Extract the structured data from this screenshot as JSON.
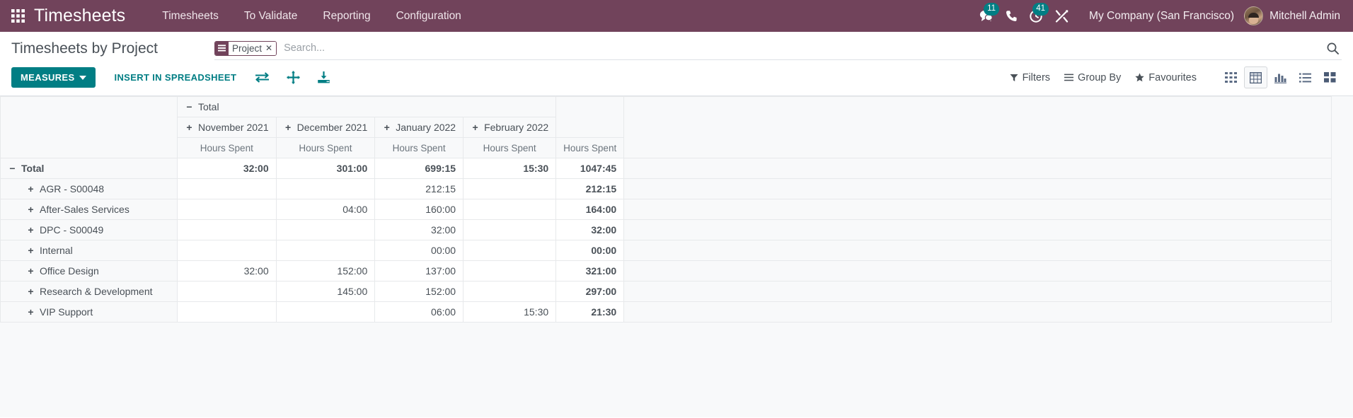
{
  "navbar": {
    "apps_icon": "apps-grid-icon",
    "brand": "Timesheets",
    "menu": [
      {
        "label": "Timesheets"
      },
      {
        "label": "To Validate"
      },
      {
        "label": "Reporting"
      },
      {
        "label": "Configuration"
      }
    ],
    "messages_badge": "11",
    "activities_badge": "41",
    "company": "My Company (San Francisco)",
    "user": "Mitchell Admin",
    "brand_color": "#71435B",
    "badge_color": "#017E84"
  },
  "control_panel": {
    "title": "Timesheets by Project",
    "search": {
      "facet_label": "Project",
      "facet_close": "✕",
      "placeholder": "Search..."
    },
    "measures_label": "MEASURES",
    "insert_label": "INSERT IN SPREADSHEET",
    "tools": [
      {
        "name": "flip-axis-icon"
      },
      {
        "name": "expand-all-icon"
      },
      {
        "name": "download-xlsx-icon"
      }
    ],
    "filters_label": "Filters",
    "groupby_label": "Group By",
    "favourites_label": "Favourites",
    "views": [
      {
        "name": "kanban-view-icon",
        "active": false
      },
      {
        "name": "pivot-view-icon",
        "active": true
      },
      {
        "name": "graph-view-icon",
        "active": false
      },
      {
        "name": "list-view-icon",
        "active": false
      },
      {
        "name": "cohort-view-icon",
        "active": false
      }
    ],
    "accent_color": "#017E84"
  },
  "pivot": {
    "col_total_label": "Total",
    "col_total_toggle": "−",
    "column_groups": [
      {
        "label": "November 2021",
        "toggle": "+"
      },
      {
        "label": "December 2021",
        "toggle": "+"
      },
      {
        "label": "January 2022",
        "toggle": "+"
      },
      {
        "label": "February 2022",
        "toggle": "+"
      }
    ],
    "measure_label": "Hours Spent",
    "measure_headers": [
      "Hours Spent",
      "Hours Spent",
      "Hours Spent",
      "Hours Spent",
      "Hours Spent"
    ],
    "row_total_label": "Total",
    "row_total_toggle": "−",
    "total_values": [
      "32:00",
      "301:00",
      "699:15",
      "15:30",
      "1047:45"
    ],
    "rows": [
      {
        "toggle": "+",
        "label": "AGR - S00048",
        "values": [
          "",
          "",
          "212:15",
          "",
          "212:15"
        ]
      },
      {
        "toggle": "+",
        "label": "After-Sales Services",
        "values": [
          "",
          "04:00",
          "160:00",
          "",
          "164:00"
        ]
      },
      {
        "toggle": "+",
        "label": "DPC - S00049",
        "values": [
          "",
          "",
          "32:00",
          "",
          "32:00"
        ]
      },
      {
        "toggle": "+",
        "label": "Internal",
        "values": [
          "",
          "",
          "00:00",
          "",
          "00:00"
        ]
      },
      {
        "toggle": "+",
        "label": "Office Design",
        "values": [
          "32:00",
          "152:00",
          "137:00",
          "",
          "321:00"
        ]
      },
      {
        "toggle": "+",
        "label": "Research & Development",
        "values": [
          "",
          "145:00",
          "152:00",
          "",
          "297:00"
        ]
      },
      {
        "toggle": "+",
        "label": "VIP Support",
        "values": [
          "",
          "",
          "06:00",
          "15:30",
          "21:30"
        ]
      }
    ]
  }
}
